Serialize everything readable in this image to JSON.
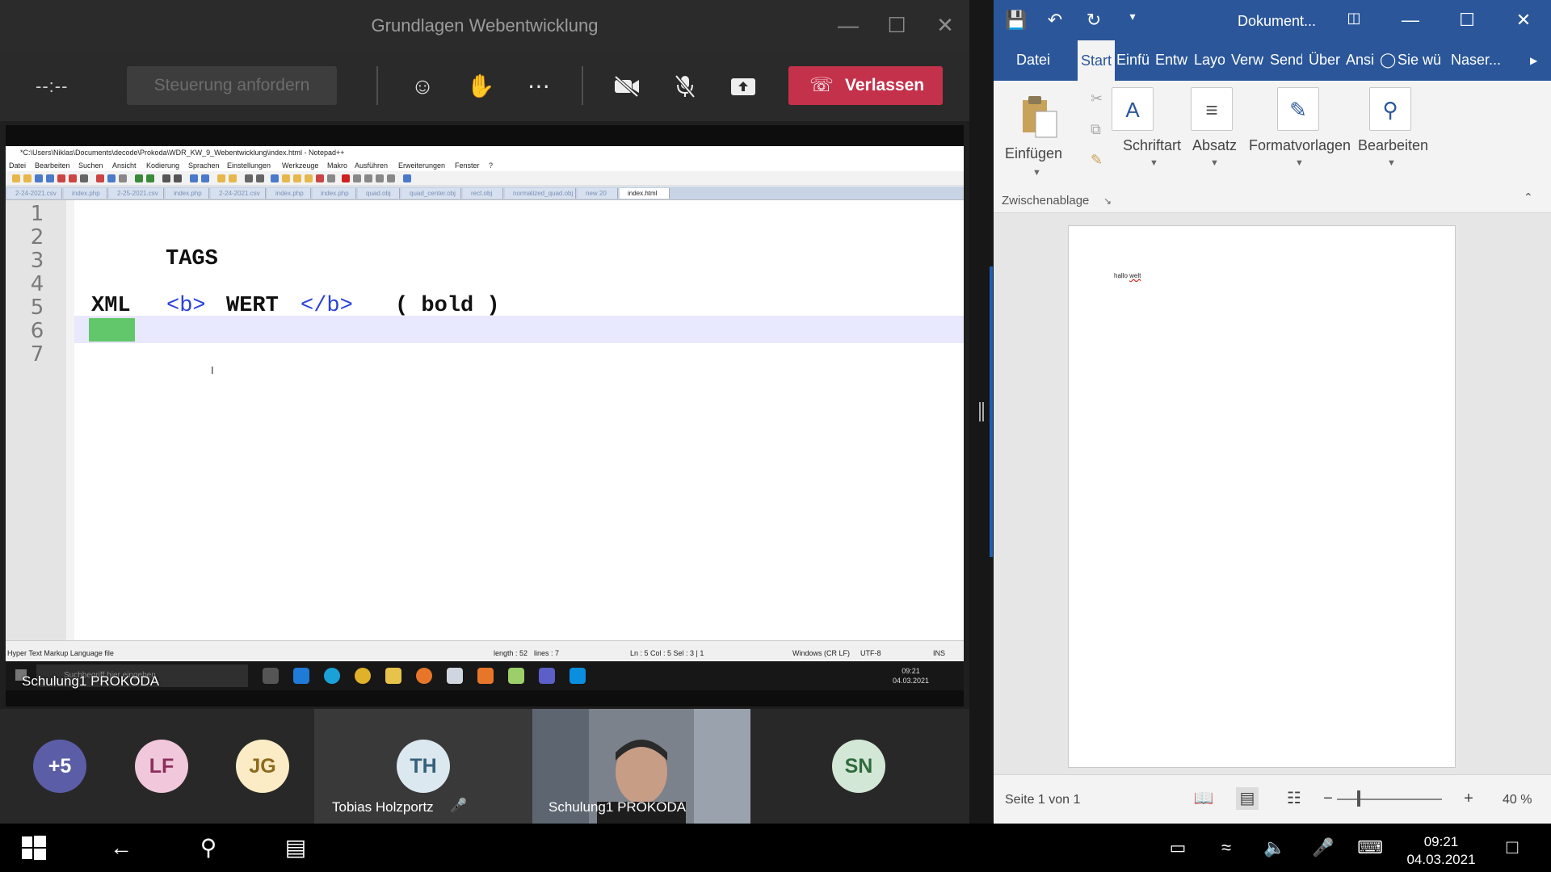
{
  "teams": {
    "window_title": "Grundlagen Webentwicklung",
    "timer": "--:--",
    "request_control": "Steuerung anfordern",
    "leave": "Verlassen",
    "share_owner": "Schulung1 PROKODA"
  },
  "notepad": {
    "title": "*C:\\Users\\Niklas\\Documents\\decode\\Prokoda\\WDR_KW_9_Webentwicklung\\index.html - Notepad++",
    "menu": [
      "Datei",
      "Bearbeiten",
      "Suchen",
      "Ansicht",
      "Kodierung",
      "Sprachen",
      "Einstellungen",
      "Werkzeuge",
      "Makro",
      "Ausführen",
      "Erweiterungen",
      "Fenster",
      "?"
    ],
    "tabs": [
      "2-24-2021.csv",
      "index.php",
      "2-25-2021.csv",
      "index.php",
      "2-24-2021.csv",
      "index.php",
      "index.php",
      "quad.obj",
      "quad_center.obj",
      "rect.obj",
      "normalized_quad.obj",
      "new 20",
      "index.html"
    ],
    "line_numbers": [
      "1",
      "2",
      "3",
      "4",
      "5",
      "6",
      "7"
    ],
    "line3": "TAGS",
    "line5_tag": "XML",
    "line5_open": "<b>",
    "line5_value": "WERT",
    "line5_close": "</b>",
    "line5_comment": "( bold )",
    "status": {
      "filetype": "Hyper Text Markup Language file",
      "length": "length : 52",
      "lines": "lines : 7",
      "position": "Ln : 5    Col : 5    Sel : 3 | 1",
      "eol": "Windows (CR LF)",
      "encoding": "UTF-8",
      "mode": "INS"
    },
    "remote_search": "Suchbegriff hier eingeben",
    "remote_time": "09:21",
    "remote_date": "04.03.2021"
  },
  "participants": {
    "more": "+5",
    "lf": "LF",
    "jg": "JG",
    "th": "TH",
    "th_name": "Tobias Holzportz",
    "video_name": "Schulung1 PROKODA",
    "sn": "SN"
  },
  "word": {
    "doc_title": "Dokument...",
    "tabs": [
      "Datei",
      "Start",
      "Einfü",
      "Entw",
      "Layo",
      "Verw",
      "Send",
      "Über",
      "Ansi"
    ],
    "tell_me": "Sie wü",
    "user": "Naser...",
    "groups": {
      "paste": "Einfügen",
      "clipboard": "Zwischenablage",
      "font": "Schriftart",
      "paragraph": "Absatz",
      "styles": "Formatvorlagen",
      "edit": "Bearbeiten"
    },
    "page_text_plain": "hallo",
    "page_text_misspelled": "welt",
    "page_count": "Seite 1 von 1",
    "zoom": "40 %"
  },
  "system": {
    "time": "09:21",
    "date": "04.03.2021"
  },
  "colors": {
    "teams_leave": "#c4314b",
    "word_blue": "#2b579a",
    "xml_highlight": "#62c66a",
    "tag_color": "#2a43d9"
  }
}
